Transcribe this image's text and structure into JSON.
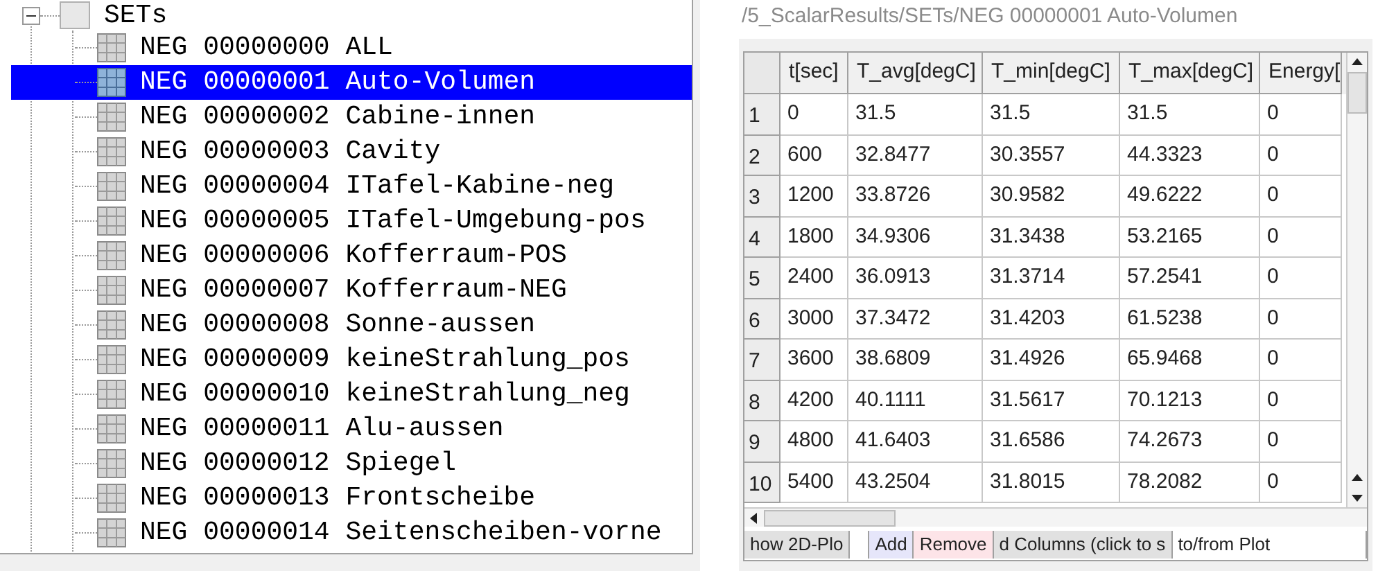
{
  "tree": {
    "root": {
      "label": "SETs",
      "expanded": true,
      "children": [
        {
          "label": "NEG 00000000 ALL",
          "selected": false
        },
        {
          "label": "NEG 00000001 Auto-Volumen",
          "selected": true
        },
        {
          "label": "NEG 00000002 Cabine-innen",
          "selected": false
        },
        {
          "label": "NEG 00000003 Cavity",
          "selected": false
        },
        {
          "label": "NEG 00000004 ITafel-Kabine-neg",
          "selected": false
        },
        {
          "label": "NEG 00000005 ITafel-Umgebung-pos",
          "selected": false
        },
        {
          "label": "NEG 00000006 Kofferraum-POS",
          "selected": false
        },
        {
          "label": "NEG 00000007 Kofferraum-NEG",
          "selected": false
        },
        {
          "label": "NEG 00000008 Sonne-aussen",
          "selected": false
        },
        {
          "label": "NEG 00000009 keineStrahlung_pos",
          "selected": false
        },
        {
          "label": "NEG 00000010 keineStrahlung_neg",
          "selected": false
        },
        {
          "label": "NEG 00000011 Alu-aussen",
          "selected": false
        },
        {
          "label": "NEG 00000012 Spiegel",
          "selected": false
        },
        {
          "label": "NEG 00000013 Frontscheibe",
          "selected": false
        },
        {
          "label": "NEG 00000014 Seitenscheiben-vorne",
          "selected": false
        }
      ]
    }
  },
  "path": "/5_ScalarResults/SETs/NEG 00000001 Auto-Volumen",
  "table": {
    "columns": [
      "t[sec]",
      "T_avg[degC]",
      "T_min[degC]",
      "T_max[degC]",
      "Energy["
    ],
    "rows": [
      {
        "header": "1",
        "cells": [
          "0",
          "31.5",
          "31.5",
          "31.5",
          "0"
        ]
      },
      {
        "header": "2",
        "cells": [
          "600",
          "32.8477",
          "30.3557",
          "44.3323",
          "0"
        ]
      },
      {
        "header": "3",
        "cells": [
          "1200",
          "33.8726",
          "30.9582",
          "49.6222",
          "0"
        ]
      },
      {
        "header": "4",
        "cells": [
          "1800",
          "34.9306",
          "31.3438",
          "53.2165",
          "0"
        ]
      },
      {
        "header": "5",
        "cells": [
          "2400",
          "36.0913",
          "31.3714",
          "57.2541",
          "0"
        ]
      },
      {
        "header": "6",
        "cells": [
          "3000",
          "37.3472",
          "31.4203",
          "61.5238",
          "0"
        ]
      },
      {
        "header": "7",
        "cells": [
          "3600",
          "38.6809",
          "31.4926",
          "65.9468",
          "0"
        ]
      },
      {
        "header": "8",
        "cells": [
          "4200",
          "40.1111",
          "31.5617",
          "70.1213",
          "0"
        ]
      },
      {
        "header": "9",
        "cells": [
          "4800",
          "41.6403",
          "31.6586",
          "74.2673",
          "0"
        ]
      },
      {
        "header": "10",
        "cells": [
          "5400",
          "43.2504",
          "31.8015",
          "78.2082",
          "0"
        ]
      }
    ]
  },
  "buttons": [
    {
      "kind": "button",
      "label": "how 2D-Plo"
    },
    {
      "kind": "field"
    },
    {
      "kind": "add",
      "label": "Add"
    },
    {
      "kind": "remove",
      "label": "Remove"
    },
    {
      "kind": "button",
      "label": "d Columns (click to s"
    },
    {
      "kind": "field",
      "label": "to/from Plot"
    }
  ]
}
